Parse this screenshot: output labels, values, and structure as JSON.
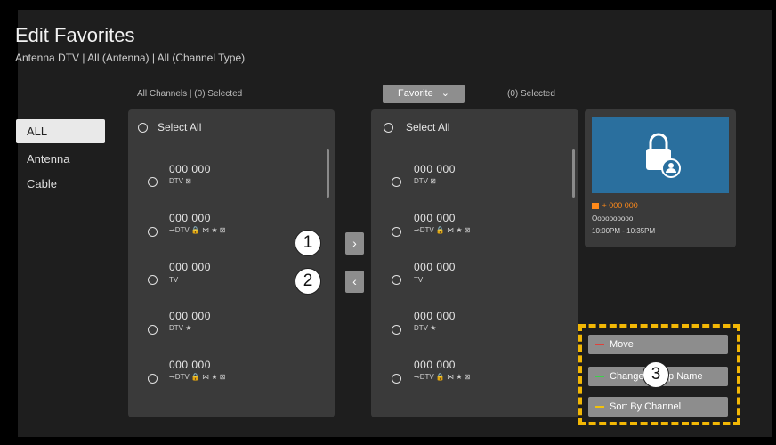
{
  "header": {
    "title": "Edit Favorites",
    "subtitle": "Antenna DTV | All (Antenna) | All (Channel Type)"
  },
  "categories": [
    "ALL",
    "Antenna",
    "Cable"
  ],
  "left_panel": {
    "header": "All Channels | (0) Selected",
    "select_all": "Select All",
    "channels": [
      {
        "number": "000 000",
        "info": "DTV ⊠"
      },
      {
        "number": "000 000",
        "info": "⊸DTV 🔒 ⋈ ★ ⊠"
      },
      {
        "number": "000 000",
        "info": "TV"
      },
      {
        "number": "000 000",
        "info": "DTV ★"
      },
      {
        "number": "000 000",
        "info": "⊸DTV 🔒 ⋈ ★ ⊠"
      }
    ]
  },
  "right_panel": {
    "dropdown": "Favorite",
    "selected": "(0) Selected",
    "select_all": "Select All",
    "channels": [
      {
        "number": "000 000",
        "info": "DTV ⊠"
      },
      {
        "number": "000 000",
        "info": "⊸DTV 🔒 ⋈ ★ ⊠"
      },
      {
        "number": "000 000",
        "info": "TV"
      },
      {
        "number": "000 000",
        "info": "DTV ★"
      },
      {
        "number": "000 000",
        "info": "⊸DTV 🔒 ⋈ ★ ⊠"
      }
    ]
  },
  "arrows": {
    "add": "›",
    "remove": "‹"
  },
  "callouts": [
    "1",
    "2",
    "3"
  ],
  "preview": {
    "channel": "+ 000 000",
    "program": "Oooooooooo",
    "time": "10:00PM - 10:35PM"
  },
  "actions": [
    {
      "label": "Move",
      "color": "#e0403a"
    },
    {
      "label": "Change Group Name",
      "color": "#3bd14a"
    },
    {
      "label": "Sort By Channel",
      "color": "#f2c20a"
    }
  ]
}
